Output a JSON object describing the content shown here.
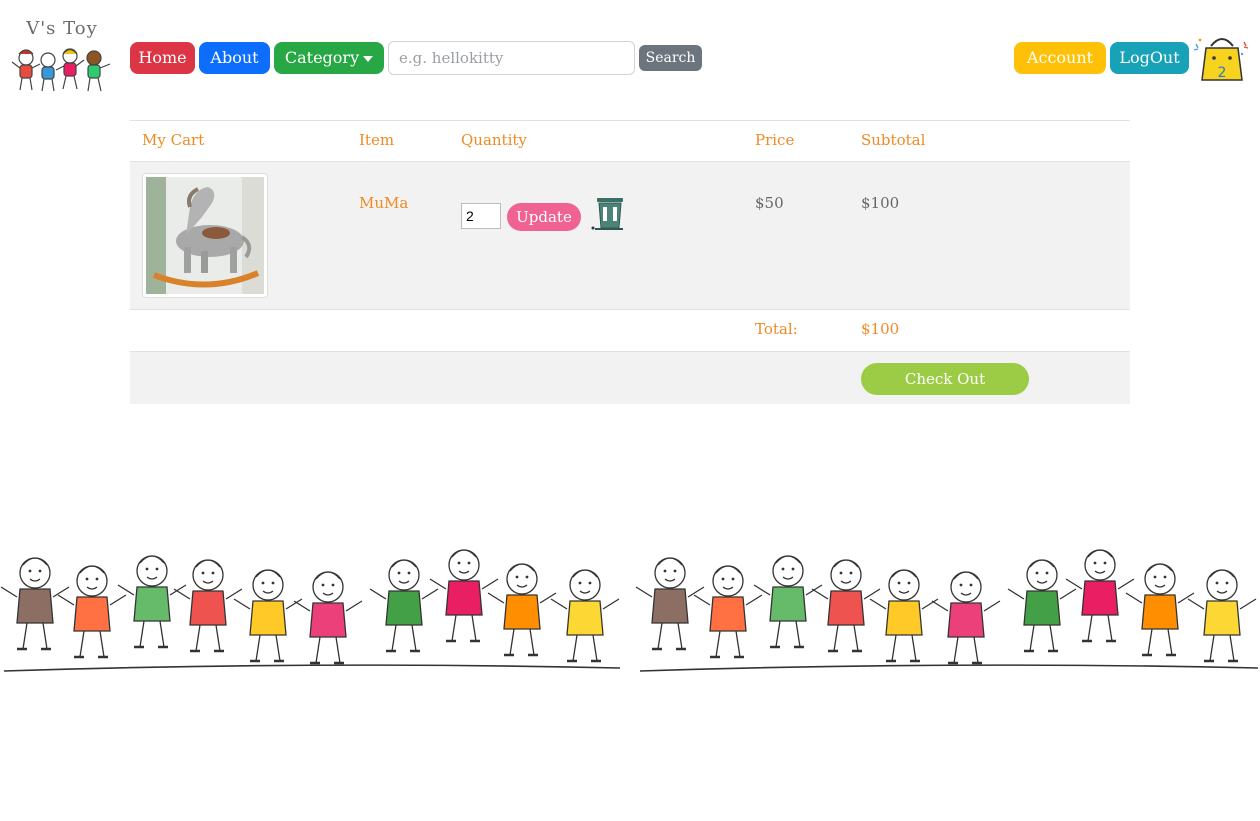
{
  "brand": {
    "name": "V's Toy"
  },
  "nav": {
    "home": "Home",
    "about": "About",
    "category": "Category",
    "search_placeholder": "e.g. hellokitty",
    "search_button": "Search",
    "account": "Account",
    "logout": "LogOut",
    "cart_count": "2"
  },
  "cart": {
    "headers": [
      "My Cart",
      "Item",
      "Quantity",
      "Price",
      "Subtotal"
    ],
    "items": [
      {
        "name": "MuMa",
        "quantity": "2",
        "price": "$50",
        "subtotal": "$100"
      }
    ],
    "update_label": "Update",
    "total_label": "Total:",
    "total_value": "$100",
    "checkout_label": "Check Out"
  },
  "colors": {
    "home": "#dc3545",
    "about": "#0d6efd",
    "category": "#28a745",
    "search": "#6c757d",
    "account": "#ffc107",
    "logout": "#17a2b8",
    "update": "#f06292",
    "checkout": "#9ccc45",
    "accent_text": "#f08a24"
  }
}
